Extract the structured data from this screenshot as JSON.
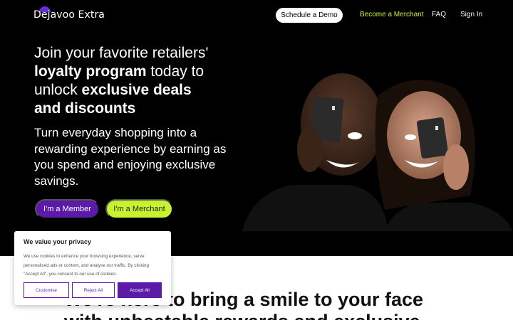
{
  "nav": {
    "logo": "Dejavoo Extra",
    "demo_button": "Schedule a Demo",
    "merchant_link": "Become a Merchant",
    "faq_link": "FAQ",
    "signin_link": "Sign In"
  },
  "hero": {
    "headline_1": "Join your favorite retailers'",
    "headline_2": "loyalty program",
    "headline_3": " today to",
    "headline_4": "unlock ",
    "headline_5": "exclusive deals",
    "headline_6": "and discounts",
    "subhead": "Turn everyday shopping into a rewarding experience by earning as you spend and enjoying exclusive savings.",
    "member_button": "I'm a Member",
    "merchant_button": "I'm a Merchant"
  },
  "mission": {
    "text": "We're here to bring a smile to your face with unbeatable rewards and exclusive"
  },
  "cookie": {
    "title": "We value your privacy",
    "body": "We use cookies to enhance your browsing experience, serve personalised ads or content, and analyse our traffic. By clicking \"Accept All\", you consent to our use of cookies.",
    "customise": "Customise",
    "reject": "Reject All",
    "accept": "Accept All"
  },
  "colors": {
    "brand_purple": "#5b1aa8",
    "accent_lime": "#c8f230"
  },
  "icons": {
    "logo_mark": "purple-half-circle"
  }
}
